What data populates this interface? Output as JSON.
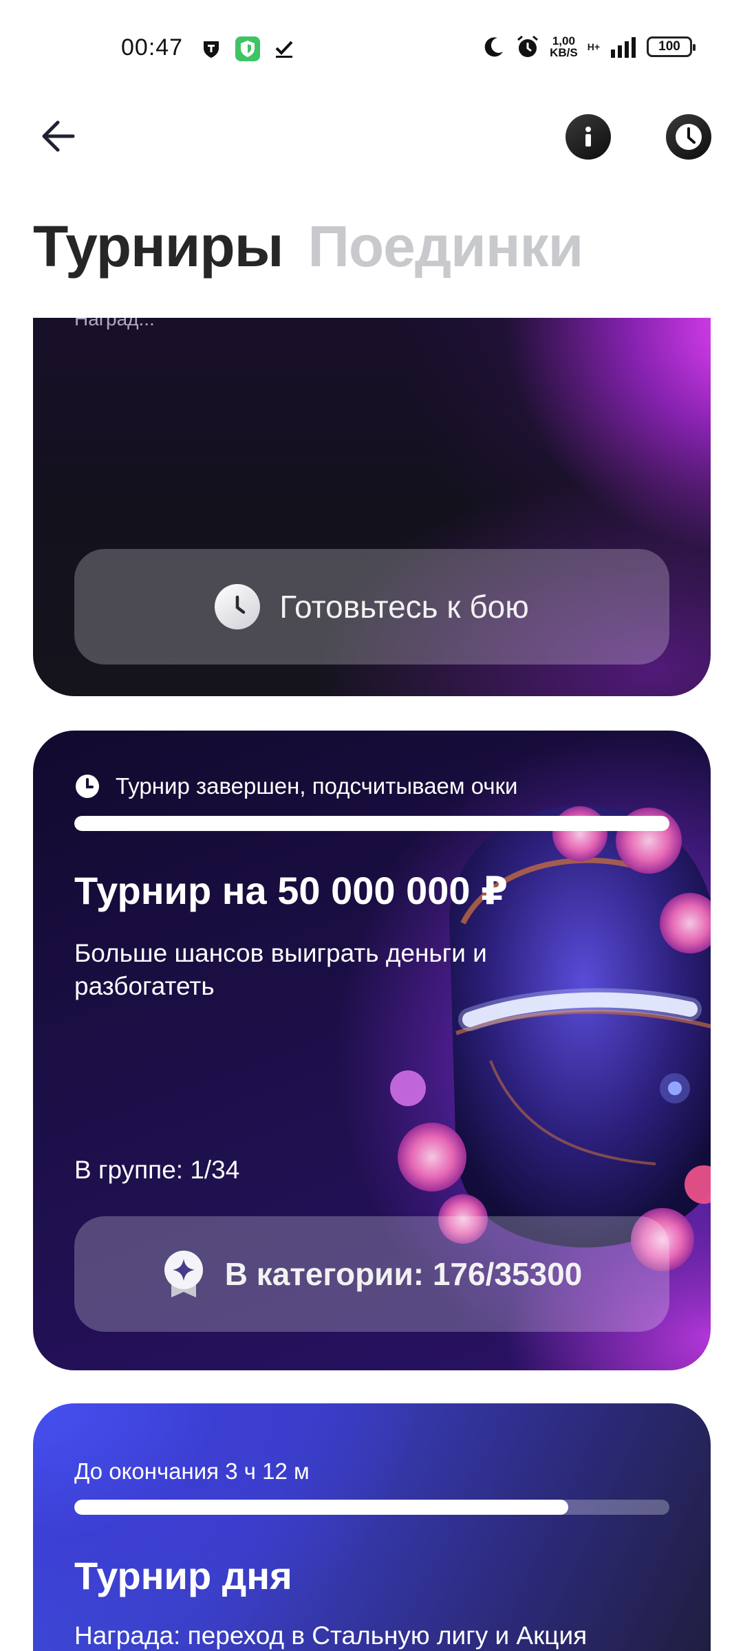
{
  "status_bar": {
    "time": "00:47",
    "net_speed_value": "1,00",
    "net_speed_unit": "KB/S",
    "network_type": "H+",
    "battery": "100"
  },
  "header": {
    "back_icon": "arrow-left-icon",
    "info_icon": "info-icon",
    "history_icon": "clock-icon"
  },
  "tabs": [
    {
      "label": "Турниры",
      "active": true
    },
    {
      "label": "Поединки",
      "active": false
    }
  ],
  "cards": [
    {
      "peek_text": "Наград...",
      "button_label": "Готовьтесь к бою",
      "button_icon": "clock-icon"
    },
    {
      "status": "Турнир завершен, подсчитываем очки",
      "progress": 1.0,
      "title": "Турнир на 50 000 000 ₽",
      "subtitle": "Больше шансов выиграть деньги и разбогатеть",
      "group": "В группе: 1/34",
      "button_label": "В категории: 176/35300",
      "button_icon": "medal-icon"
    },
    {
      "status": "До окончания 3 ч 12 м",
      "progress": 0.83,
      "title": "Турнир дня",
      "subtitle": "Награда: переход в Стальную лигу и Акция"
    }
  ]
}
